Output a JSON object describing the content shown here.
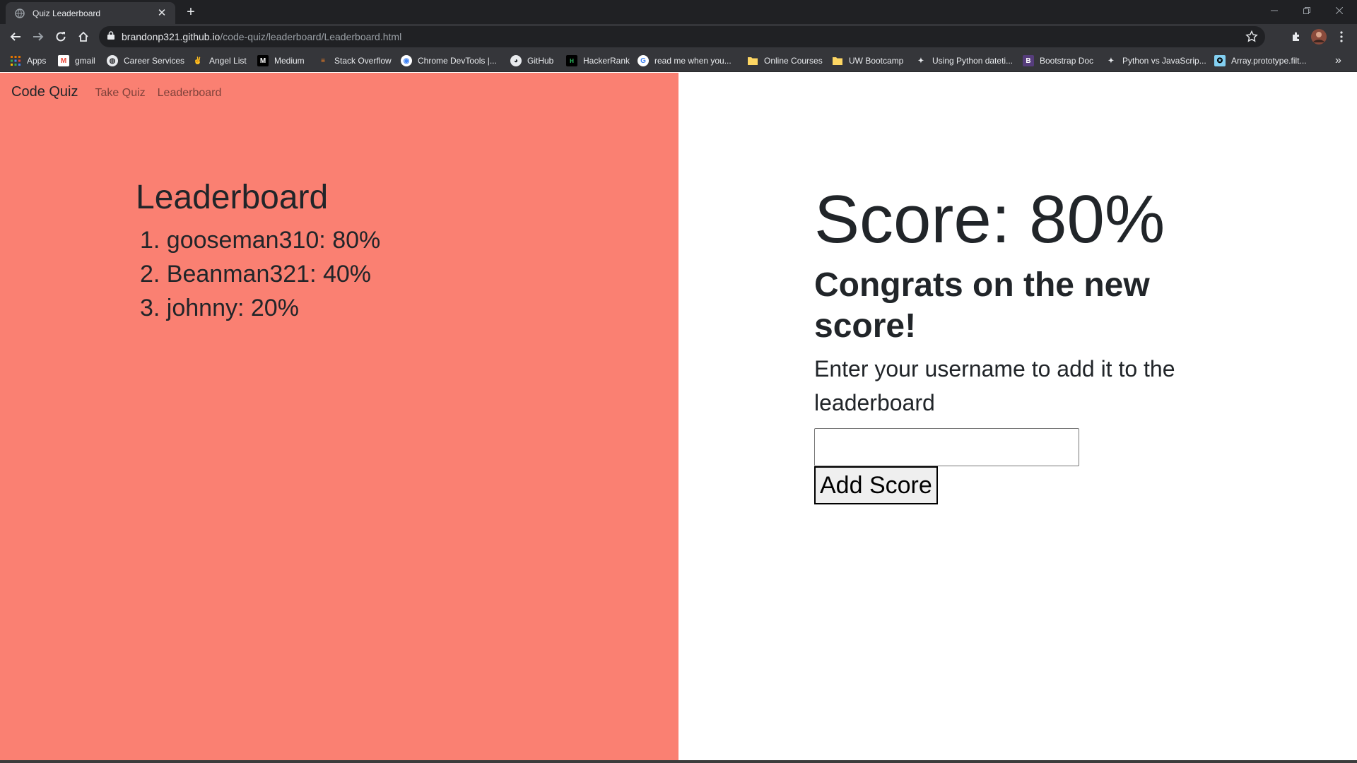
{
  "browser": {
    "tab_title": "Quiz Leaderboard",
    "url_host": "brandonp321.github.io",
    "url_path": "/code-quiz/leaderboard/Leaderboard.html",
    "bookmarks": [
      {
        "label": "Apps",
        "icon": "apps-grid-icon"
      },
      {
        "label": "gmail",
        "icon": "gmail-icon"
      },
      {
        "label": "Career Services",
        "icon": "globe-icon"
      },
      {
        "label": "Angel List",
        "icon": "angellist-icon"
      },
      {
        "label": "Medium",
        "icon": "medium-icon"
      },
      {
        "label": "Stack Overflow",
        "icon": "stackoverflow-icon"
      },
      {
        "label": "Chrome DevTools |...",
        "icon": "chrome-devtools-icon"
      },
      {
        "label": "GitHub",
        "icon": "github-icon"
      },
      {
        "label": "HackerRank",
        "icon": "hackerrank-icon"
      },
      {
        "label": "read me when you...",
        "icon": "google-icon"
      },
      {
        "label": "Online Courses",
        "icon": "folder-icon"
      },
      {
        "label": "UW Bootcamp",
        "icon": "folder-icon"
      },
      {
        "label": "Using Python dateti...",
        "icon": "python-icon"
      },
      {
        "label": "Bootstrap Doc",
        "icon": "bootstrap-icon"
      },
      {
        "label": "Python vs JavaScrip...",
        "icon": "python-icon"
      },
      {
        "label": "Array.prototype.filt...",
        "icon": "mdn-icon"
      }
    ],
    "overflow_label": "»"
  },
  "nav": {
    "brand": "Code Quiz",
    "links": [
      "Take Quiz",
      "Leaderboard"
    ]
  },
  "leaderboard": {
    "title": "Leaderboard",
    "entries": [
      "1. gooseman310: 80%",
      "2. Beanman321: 40%",
      "3. johnny: 20%"
    ]
  },
  "result": {
    "score": "Score: 80%",
    "congrats": "Congrats on the new score!",
    "instruction": "Enter your username to add it to the leaderboard",
    "username_value": "",
    "add_button": "Add Score"
  },
  "colors": {
    "left_panel": "#fa8072",
    "text": "#212529",
    "chrome_dark": "#202124",
    "chrome_toolbar": "#35363a"
  }
}
